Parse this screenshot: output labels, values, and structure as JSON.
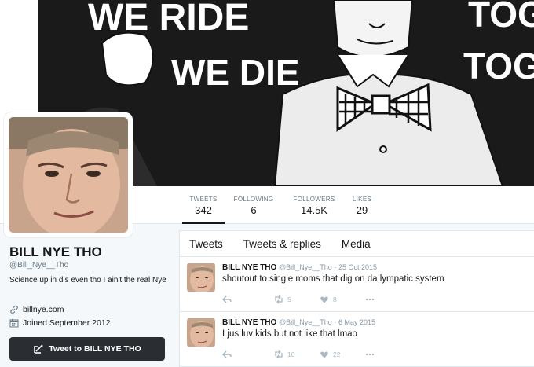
{
  "profile": {
    "name": "BILL NYE THO",
    "handle": "@Bill_Nye__Tho",
    "bio": "Science up in dis even tho I ain't the real Nye",
    "website": "billnye.com",
    "joined": "Joined September 2012",
    "tweet_to_label": "Tweet to BILL NYE THO"
  },
  "banner": {
    "text_line1": "WE RIDE",
    "text_line2": "WE DIE",
    "text_right1": "TOG",
    "text_right2": "TOG"
  },
  "stats": [
    {
      "label": "TWEETS",
      "value": "342"
    },
    {
      "label": "FOLLOWING",
      "value": "6"
    },
    {
      "label": "FOLLOWERS",
      "value": "14.5K"
    },
    {
      "label": "LIKES",
      "value": "29"
    }
  ],
  "tabs": [
    {
      "label": "Tweets"
    },
    {
      "label": "Tweets & replies"
    },
    {
      "label": "Media"
    }
  ],
  "tweets": [
    {
      "name": "BILL NYE THO",
      "handle": "@Bill_Nye__Tho",
      "date": "· 25 Oct 2015",
      "text": "shoutout to single moms that dig on da lympatic system",
      "retweets": "5",
      "likes": "8"
    },
    {
      "name": "BILL NYE THO",
      "handle": "@Bill_Nye__Tho",
      "date": "· 6 May 2015",
      "text": "I jus luv kids but not like that lmao",
      "retweets": "10",
      "likes": "22"
    }
  ],
  "colors": {
    "accent_dark": "#2a2e33",
    "muted_text": "#657786",
    "action_gray": "#aab8c2"
  },
  "icons": [
    "link-icon",
    "calendar-icon",
    "compose-icon",
    "reply-icon",
    "retweet-icon",
    "heart-icon",
    "more-icon"
  ]
}
